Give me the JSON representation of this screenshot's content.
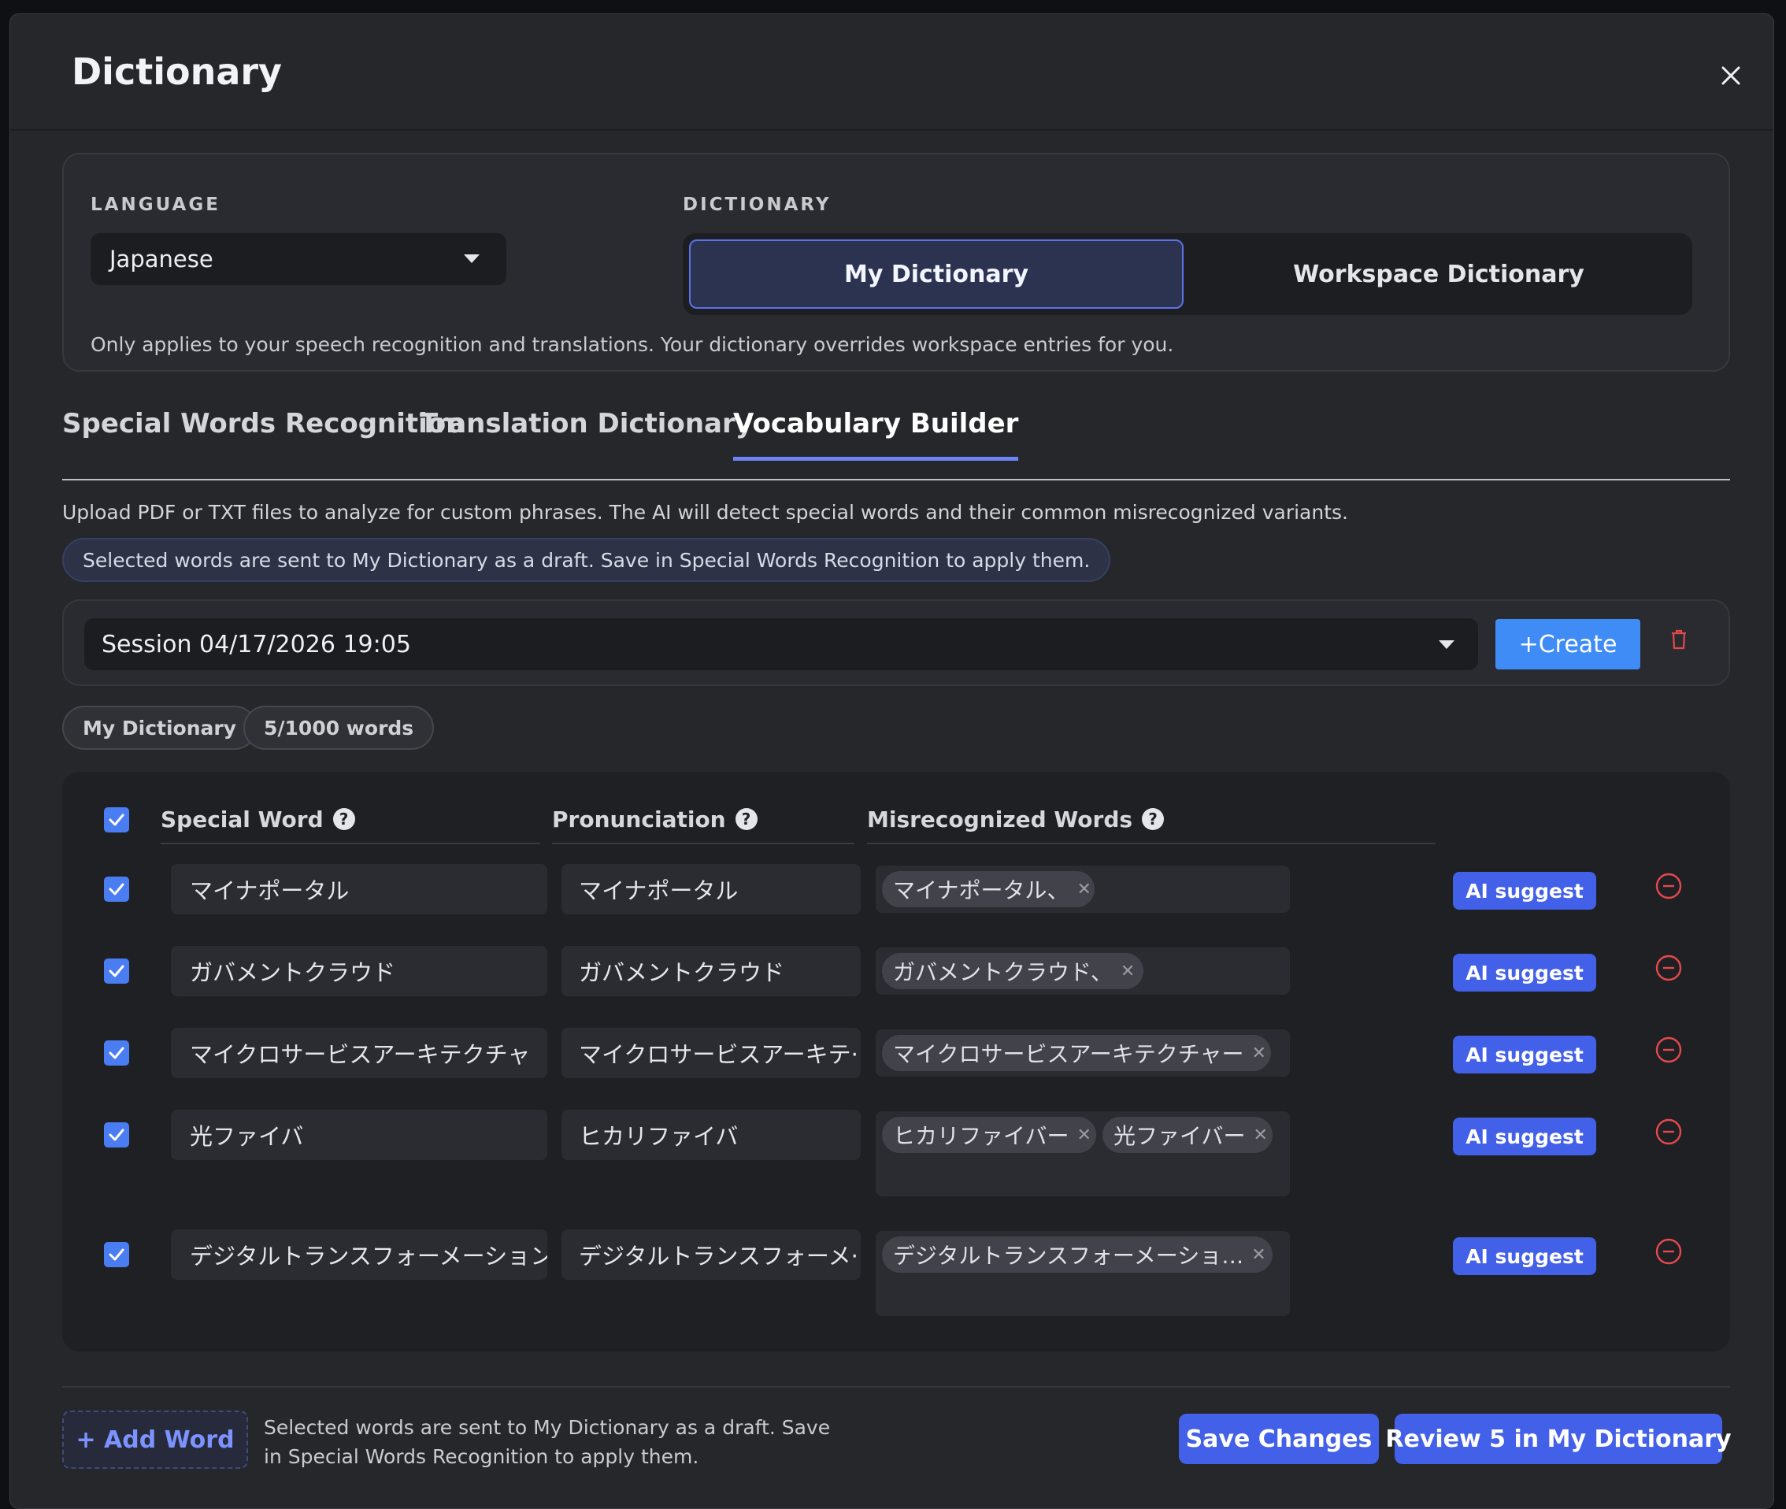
{
  "modal": {
    "title": "Dictionary"
  },
  "settings": {
    "language_label": "LANGUAGE",
    "language_value": "Japanese",
    "dictionary_label": "DICTIONARY",
    "dictionary_options": [
      "My Dictionary",
      "Workspace Dictionary"
    ],
    "dictionary_selected": "My Dictionary",
    "note": "Only applies to your speech recognition and translations. Your dictionary overrides workspace entries for you."
  },
  "tabs": [
    {
      "label": "Special Words Recognition",
      "active": false
    },
    {
      "label": "Translation Dictionary",
      "active": false
    },
    {
      "label": "Vocabulary Builder",
      "active": true
    }
  ],
  "vocab": {
    "intro": "Upload PDF or TXT files to analyze for custom phrases. The AI will detect special words and their common misrecognized variants.",
    "info_pill": "Selected words are sent to My Dictionary as a draft. Save in Special Words Recognition to apply them.",
    "session_value": "Session 04/17/2026 19:05",
    "create_label": "+Create",
    "chip_dictionary": "My Dictionary",
    "chip_count": "5/1000 words"
  },
  "table": {
    "headers": [
      "Special Word",
      "Pronunciation",
      "Misrecognized Words"
    ],
    "ai_suggest_label": "AI suggest",
    "rows": [
      {
        "checked": true,
        "word": "マイナポータル",
        "pronunciation": "マイナポータル",
        "misrecognized": [
          "マイナポータル、"
        ]
      },
      {
        "checked": true,
        "word": "ガバメントクラウド",
        "pronunciation": "ガバメントクラウド",
        "misrecognized": [
          "ガバメントクラウド、"
        ]
      },
      {
        "checked": true,
        "word": "マイクロサービスアーキテクチャ",
        "pronunciation": "マイクロサービスアーキテ·",
        "misrecognized": [
          "マイクロサービスアーキテクチャー"
        ]
      },
      {
        "checked": true,
        "word": "光ファイバ",
        "pronunciation": "ヒカリファイバ",
        "misrecognized": [
          "ヒカリファイバー",
          "光ファイバー"
        ]
      },
      {
        "checked": true,
        "word": "デジタルトランスフォーメーション",
        "pronunciation": "デジタルトランスフォーメ·",
        "misrecognized": [
          "デジタルトランスフォーメーショ…"
        ]
      }
    ]
  },
  "footer": {
    "add_word_label": "+ Add Word",
    "note": "Selected words are sent to My Dictionary as a draft. Save in Special Words Recognition to apply them.",
    "save_label": "Save Changes",
    "review_label": "Review 5 in My Dictionary"
  },
  "colors": {
    "accent": "#4360e8",
    "create_button": "#3f8cf6",
    "danger": "#e5484d",
    "checkbox": "#4a7cf2"
  }
}
